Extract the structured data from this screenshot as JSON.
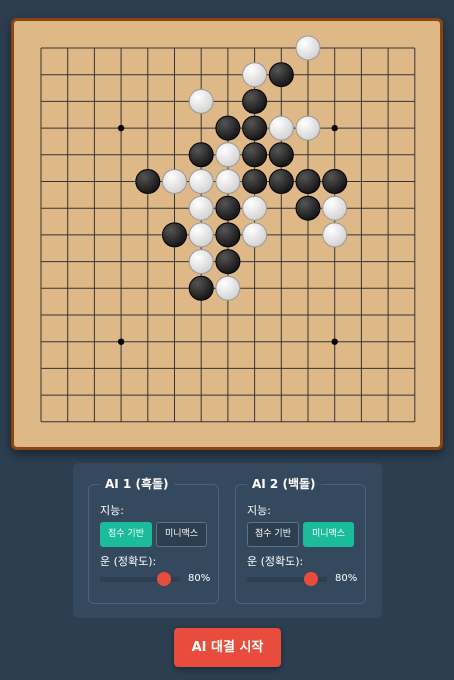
{
  "colors": {
    "page_bg": "#2c3e50",
    "board_bg": "#deb887",
    "board_border": "#8b4513",
    "grid_line": "#333333",
    "active_button": "#1abc9c",
    "slider_thumb": "#e74c3c",
    "start_button": "#e74c3c"
  },
  "board": {
    "size": 15,
    "star_points": [
      [
        3,
        3
      ],
      [
        11,
        3
      ],
      [
        3,
        11
      ],
      [
        11,
        11
      ]
    ],
    "stones": [
      {
        "color": "white",
        "col": 10,
        "row": 0
      },
      {
        "color": "white",
        "col": 8,
        "row": 1
      },
      {
        "color": "black",
        "col": 9,
        "row": 1
      },
      {
        "color": "white",
        "col": 6,
        "row": 2
      },
      {
        "color": "black",
        "col": 8,
        "row": 2
      },
      {
        "color": "black",
        "col": 7,
        "row": 3
      },
      {
        "color": "black",
        "col": 8,
        "row": 3
      },
      {
        "color": "white",
        "col": 9,
        "row": 3
      },
      {
        "color": "white",
        "col": 10,
        "row": 3
      },
      {
        "color": "black",
        "col": 6,
        "row": 4
      },
      {
        "color": "white",
        "col": 7,
        "row": 4
      },
      {
        "color": "black",
        "col": 8,
        "row": 4
      },
      {
        "color": "black",
        "col": 9,
        "row": 4
      },
      {
        "color": "black",
        "col": 4,
        "row": 5
      },
      {
        "color": "white",
        "col": 5,
        "row": 5
      },
      {
        "color": "white",
        "col": 6,
        "row": 5
      },
      {
        "color": "white",
        "col": 7,
        "row": 5
      },
      {
        "color": "black",
        "col": 8,
        "row": 5
      },
      {
        "color": "black",
        "col": 9,
        "row": 5
      },
      {
        "color": "black",
        "col": 10,
        "row": 5
      },
      {
        "color": "black",
        "col": 11,
        "row": 5
      },
      {
        "color": "white",
        "col": 6,
        "row": 6
      },
      {
        "color": "black",
        "col": 7,
        "row": 6
      },
      {
        "color": "white",
        "col": 8,
        "row": 6
      },
      {
        "color": "black",
        "col": 10,
        "row": 6
      },
      {
        "color": "white",
        "col": 11,
        "row": 6
      },
      {
        "color": "black",
        "col": 5,
        "row": 7
      },
      {
        "color": "white",
        "col": 6,
        "row": 7
      },
      {
        "color": "black",
        "col": 7,
        "row": 7
      },
      {
        "color": "white",
        "col": 8,
        "row": 7
      },
      {
        "color": "white",
        "col": 11,
        "row": 7
      },
      {
        "color": "white",
        "col": 6,
        "row": 8
      },
      {
        "color": "black",
        "col": 7,
        "row": 8
      },
      {
        "color": "black",
        "col": 6,
        "row": 9
      },
      {
        "color": "white",
        "col": 7,
        "row": 9
      }
    ]
  },
  "ai1": {
    "title": "AI 1 (흑돌)",
    "intelligence_label": "지능:",
    "options": [
      "점수 기반",
      "미니맥스"
    ],
    "selected": 0,
    "luck_label": "운 (정확도):",
    "luck_value": 80,
    "luck_text": "80%"
  },
  "ai2": {
    "title": "AI 2 (백돌)",
    "intelligence_label": "지능:",
    "options": [
      "점수 기반",
      "미니맥스"
    ],
    "selected": 1,
    "luck_label": "운 (정확도):",
    "luck_value": 80,
    "luck_text": "80%"
  },
  "start_button": "AI 대결 시작"
}
